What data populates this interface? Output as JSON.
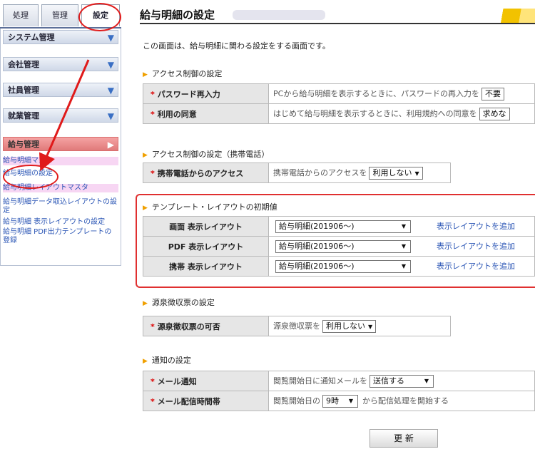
{
  "sidebar": {
    "tabs": [
      "処理",
      "管理",
      "設定"
    ],
    "sections": [
      {
        "label": "システム管理",
        "arrow": "▼"
      },
      {
        "label": "会社管理",
        "arrow": "▼"
      },
      {
        "label": "社員管理",
        "arrow": "▼"
      },
      {
        "label": "就業管理",
        "arrow": "▼"
      },
      {
        "label": "給与管理",
        "arrow": "▶"
      }
    ],
    "pay_items": [
      "給与明細マスタ",
      "給与明細の設定",
      "給与明細レイアウトマスタ",
      "給与明細データ取込レイアウトの設定",
      "給与明細 表示レイアウトの設定",
      "給与明細 PDF出力テンプレートの登録"
    ]
  },
  "main": {
    "title": "給与明細の設定",
    "description": "この画面は、給与明細に関わる設定をする画面です。",
    "sections": {
      "access": {
        "heading": "アクセス制御の設定",
        "rows": [
          {
            "star": "*",
            "label": "パスワード再入力",
            "text": "PCから給与明細を表示するときに、パスワードの再入力を",
            "select": "不要"
          },
          {
            "star": "*",
            "label": "利用の同意",
            "text": "はじめて給与明細を表示するときに、利用規約への同意を",
            "select": "求めな"
          }
        ]
      },
      "mobile": {
        "heading": "アクセス制御の設定（携帯電話）",
        "rows": [
          {
            "star": "*",
            "label": "携帯電話からのアクセス",
            "text": "携帯電話からのアクセスを",
            "select": "利用しない"
          }
        ]
      },
      "template": {
        "heading": "テンプレート・レイアウトの初期値",
        "rows": [
          {
            "label": "画面 表示レイアウト",
            "select": "給与明細(201906～)",
            "link": "表示レイアウトを追加"
          },
          {
            "label": "PDF 表示レイアウト",
            "select": "給与明細(201906～)",
            "link": "表示レイアウトを追加"
          },
          {
            "label": "携帯 表示レイアウト",
            "select": "給与明細(201906～)",
            "link": "表示レイアウトを追加"
          }
        ]
      },
      "withholding": {
        "heading": "源泉徴収票の設定",
        "rows": [
          {
            "star": "*",
            "label": "源泉徴収票の可否",
            "text": "源泉徴収票を",
            "select": "利用しない"
          }
        ]
      },
      "notify": {
        "heading": "通知の設定",
        "rows": [
          {
            "star": "*",
            "label": "メール通知",
            "text": "閲覧開始日に通知メールを",
            "select": "送信する"
          },
          {
            "star": "*",
            "label": "メール配信時間帯",
            "text": "閲覧開始日の",
            "select": "9時",
            "suffix": "から配信処理を開始する"
          }
        ]
      }
    },
    "update_button": "更 新"
  },
  "colors": {
    "accent_red": "#e01a1a",
    "link_blue": "#2a55b5",
    "pink_highlight": "#f7d6f3"
  }
}
